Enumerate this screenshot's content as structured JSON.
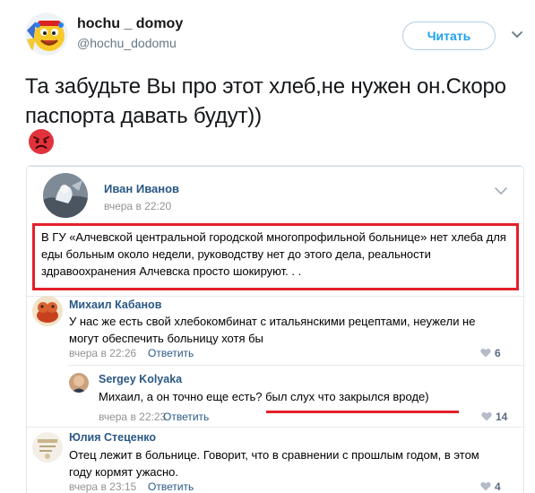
{
  "tweet": {
    "display_name": "hochu _ domoy",
    "handle": "@hochu_dodomu",
    "follow_label": "Читать",
    "text": "Та забудьте Вы про этот хлеб,не нужен он.Скоро паспорта давать будут))"
  },
  "post": {
    "author": "Иван Иванов",
    "time": "вчера в 22:20",
    "text": "В ГУ «Алчевской центральной городской многопрофильной больнице» нет хлеба для еды больным около недели, руководству нет до этого дела, реальности здравоохранения Алчевска просто шокируют. . ."
  },
  "comments": [
    {
      "author": "Михаил Кабанов",
      "text": "У нас же есть свой хлебокомбинат с итальянскими рецептами, неужели не могут обеспечить больницу хотя бы",
      "time": "вчера в 22:26",
      "reply_label": "Ответить",
      "likes": "6"
    },
    {
      "author": "Sergey Kolyaka",
      "text": "Михаил, а он точно еще есть? был слух что закрылся вроде)",
      "time": "вчера в 22:23",
      "reply_label": "Ответить",
      "likes": "14"
    },
    {
      "author": "Юлия Стеценко",
      "text": "Отец лежит в больнице. Говорит, что в сравнении с прошлым годом, в этом году кормят ужасно.",
      "time": "вчера в 23:15",
      "reply_label": "Ответить",
      "likes": "4"
    }
  ],
  "colors": {
    "twitter_blue": "#1da1f2",
    "vk_link": "#2a5885",
    "highlight_red": "#e3212a"
  },
  "icons": [
    "emoji-avatar-icon",
    "chevron-down-icon",
    "angry-face-icon",
    "heart-icon"
  ]
}
